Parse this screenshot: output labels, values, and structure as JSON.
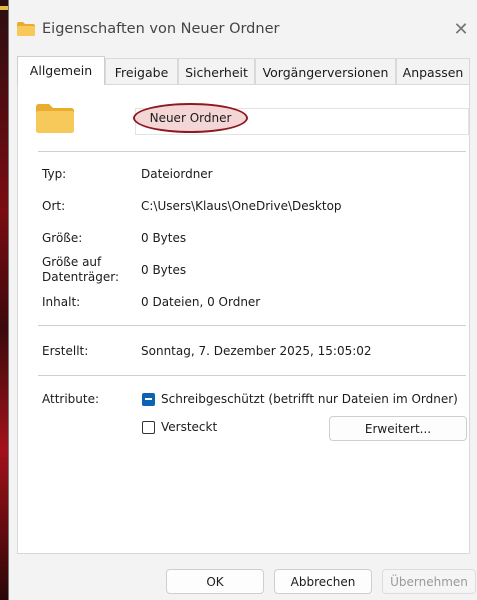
{
  "window": {
    "title": "Eigenschaften von Neuer Ordner",
    "close_glyph": "✕"
  },
  "tabs": [
    {
      "label": "Allgemein",
      "active": true
    },
    {
      "label": "Freigabe"
    },
    {
      "label": "Sicherheit"
    },
    {
      "label": "Vorgängerversionen"
    },
    {
      "label": "Anpassen"
    }
  ],
  "general": {
    "folder_name": "Neuer Ordner",
    "rows": {
      "type": {
        "label": "Typ:",
        "value": "Dateiordner"
      },
      "location": {
        "label": "Ort:",
        "value": "C:\\Users\\Klaus\\OneDrive\\Desktop"
      },
      "size": {
        "label": "Größe:",
        "value": "0 Bytes"
      },
      "size_on_disk": {
        "label": "Größe auf Datenträger:",
        "value": "0 Bytes"
      },
      "contents": {
        "label": "Inhalt:",
        "value": "0 Dateien, 0 Ordner"
      },
      "created": {
        "label": "Erstellt:",
        "value": "Sonntag, 7. Dezember 2025, 15:05:02"
      }
    },
    "attributes": {
      "label": "Attribute:",
      "readonly_label": "Schreibgeschützt (betrifft nur Dateien im Ordner)",
      "readonly_state": "indeterminate",
      "hidden_label": "Versteckt",
      "hidden_state": "unchecked",
      "advanced_button": "Erweitert..."
    }
  },
  "footer": {
    "ok": "OK",
    "cancel": "Abbrechen",
    "apply": "Übernehmen"
  },
  "colors": {
    "accent": "#0a63b3",
    "highlight_oval": "#8b1a22",
    "folder": "#f2c14e"
  }
}
